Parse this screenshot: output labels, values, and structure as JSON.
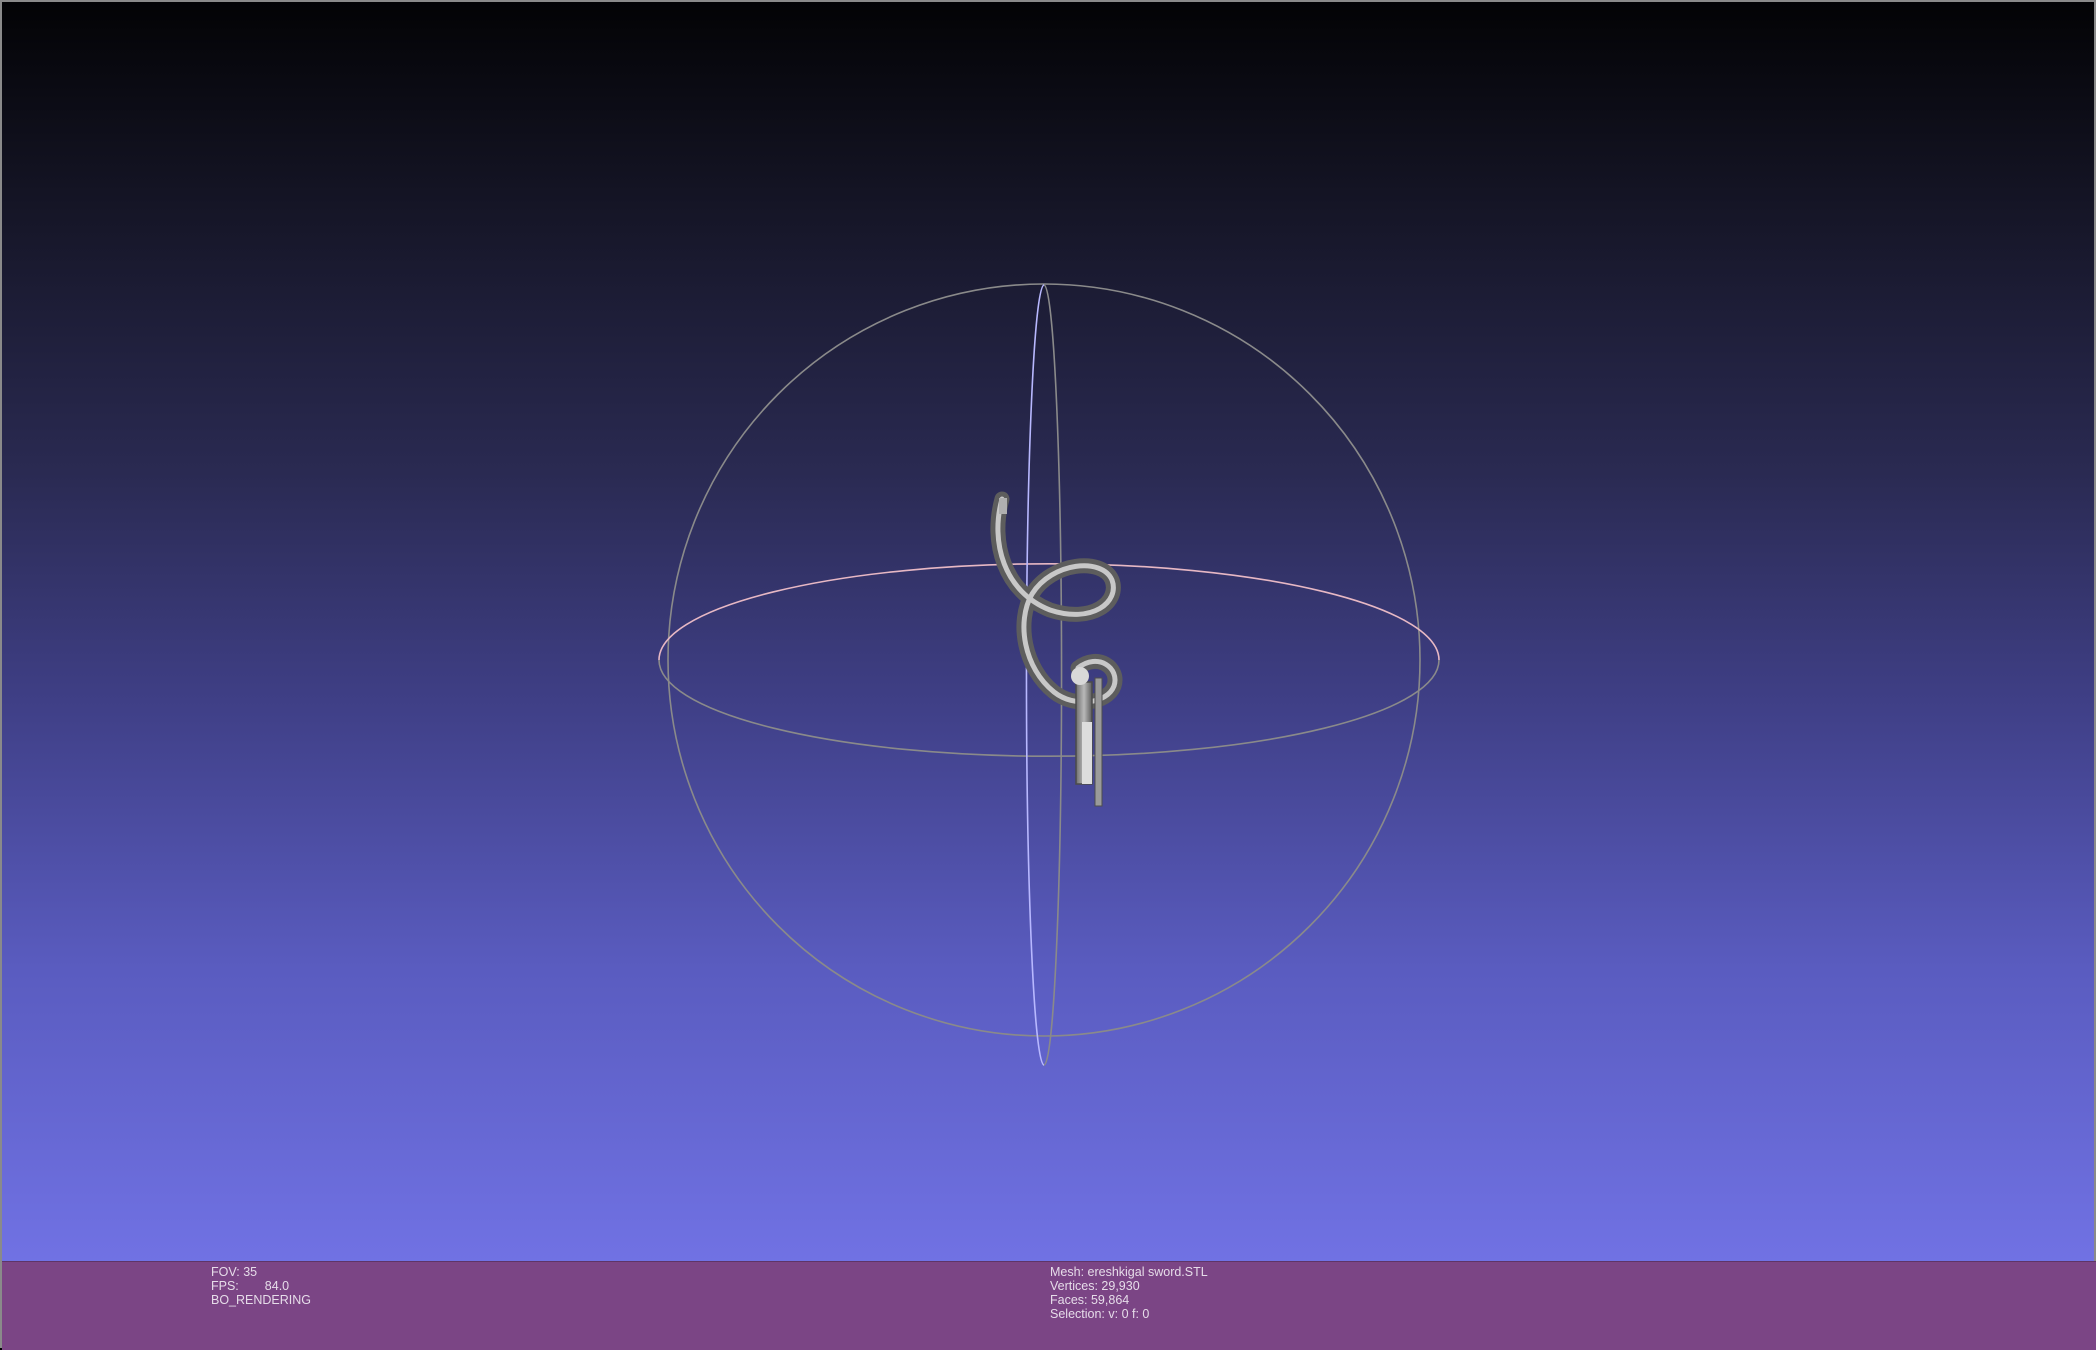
{
  "app": {
    "left_info": {
      "fov_label": "FOV:",
      "fov_value": "35",
      "fps_label": "FPS:",
      "fps_value": "84.0",
      "render_mode": "BO_RENDERING"
    },
    "right_info": {
      "mesh_line": "Mesh: ereshkigal sword.STL",
      "vertices_line": "Vertices: 29,930",
      "faces_line": "Faces: 59,864",
      "selection_line": "Selection: v: 0 f: 0"
    }
  },
  "colors": {
    "background_top": "#030305",
    "background_bottom": "#7778ee",
    "status_bar": "#7b4585",
    "trackball_horizontal": "#e7b8c4",
    "trackball_vertical": "#b8b8ff",
    "trackball_outline": "#8a8a8a",
    "mesh": "#8e8e8e"
  },
  "icons": {
    "model": "sword-mesh",
    "manipulator": "trackball-gizmo"
  }
}
